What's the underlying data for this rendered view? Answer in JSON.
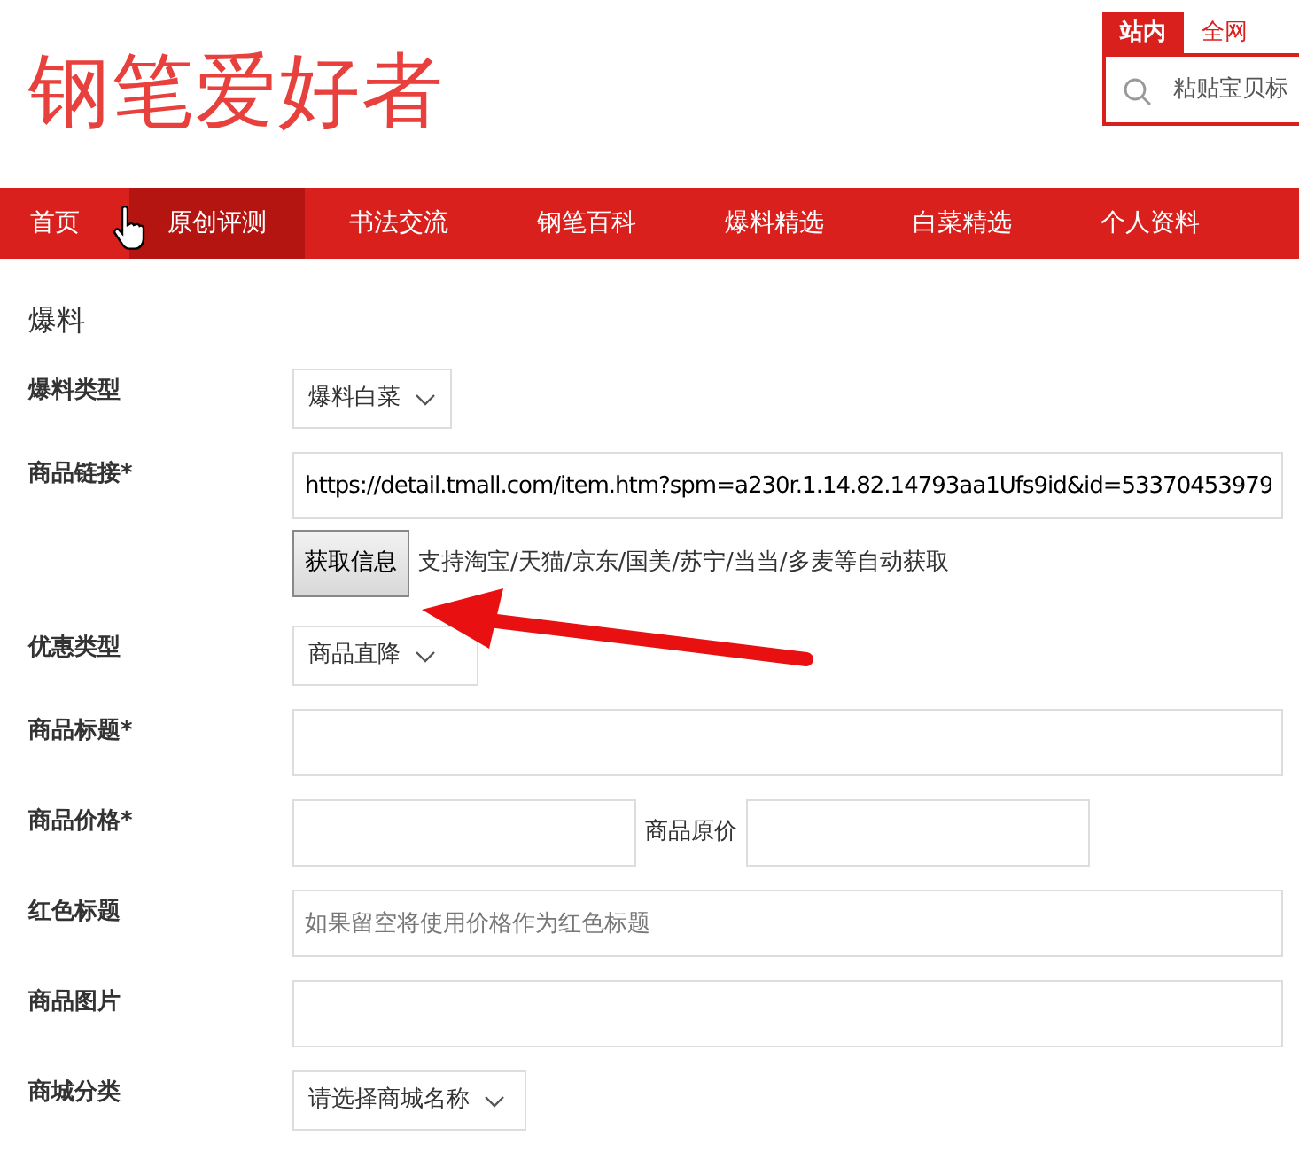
{
  "logo": "钢笔爱好者",
  "search": {
    "scopes": [
      {
        "label": "站内",
        "selected": true
      },
      {
        "label": "全网",
        "selected": false
      }
    ],
    "placeholder": "粘贴宝贝标"
  },
  "nav": [
    {
      "label": "首页",
      "selected": false
    },
    {
      "label": "原创评测",
      "selected": true
    },
    {
      "label": "书法交流",
      "selected": false
    },
    {
      "label": "钢笔百科",
      "selected": false
    },
    {
      "label": "爆料精选",
      "selected": false
    },
    {
      "label": "白菜精选",
      "selected": false
    },
    {
      "label": "个人资料",
      "selected": false
    }
  ],
  "section_title": "爆料",
  "form": [
    {
      "kind": "select",
      "label": "爆料类型",
      "value": "爆料白菜"
    },
    {
      "kind": "text",
      "label": "商品链接*",
      "value": "https://detail.tmall.com/item.htm?spm=a230r.1.14.82.14793aa1Ufs9id&id=53370453979"
    },
    {
      "kind": "button",
      "button": "获取信息",
      "help": "支持淘宝/天猫/京东/国美/苏宁/当当/多麦等自动获取"
    },
    {
      "kind": "select",
      "label": "优惠类型",
      "value": "商品直降"
    },
    {
      "kind": "text",
      "label": "商品标题*"
    },
    {
      "kind": "pair",
      "label": "商品价格*",
      "second_label": "商品原价"
    },
    {
      "kind": "text",
      "label": "红色标题",
      "placeholder": "如果留空将使用价格作为红色标题"
    },
    {
      "kind": "text",
      "label": "商品图片"
    },
    {
      "kind": "select",
      "label": "商城分类",
      "value": "请选择商城名称"
    }
  ]
}
